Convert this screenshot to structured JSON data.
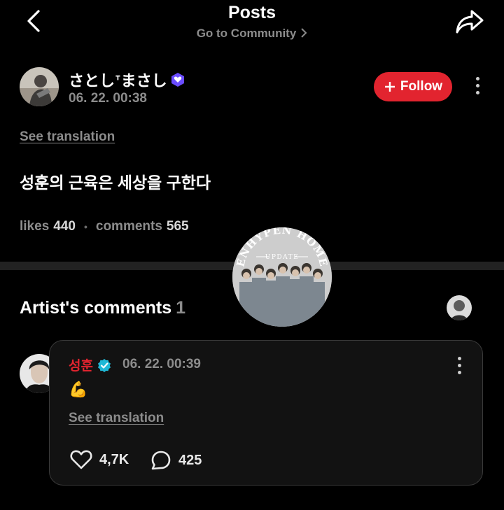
{
  "header": {
    "title": "Posts",
    "subtitle": "Go to Community",
    "back_icon": "chevron-left-icon",
    "share_icon": "share-arrow-icon"
  },
  "post": {
    "author": "さとしᐪまさし",
    "timestamp": "06. 22. 00:38",
    "follow_label": "Follow",
    "see_translation": "See translation",
    "text": "성훈의 근육은 세상을 구한다",
    "likes_label": "likes",
    "likes_count": "440",
    "comments_label": "comments",
    "comments_count": "565"
  },
  "artist_comments": {
    "title": "Artist's comments",
    "count": "1",
    "comment": {
      "author": "성훈",
      "timestamp": "06. 22. 00:39",
      "emoji": "💪",
      "see_translation": "See translation",
      "likes": "4,7K",
      "replies": "425"
    }
  },
  "watermark": {
    "line1": "ENHYPEN HOME",
    "line2": "UPDATE"
  },
  "colors": {
    "accent_red": "#e2242f",
    "verified_blue": "#1fb8d6",
    "muted_text": "#8c8c8c",
    "background": "#000000"
  }
}
